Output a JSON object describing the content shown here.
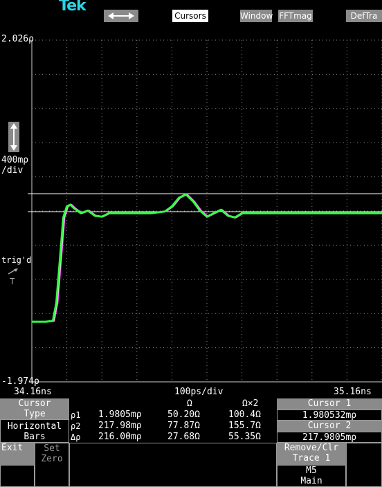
{
  "brand": "Tek",
  "top_menu": {
    "arrows_icon": "left-right-arrow-icon",
    "cursors": "Cursors",
    "window": "Window",
    "fftmag": "FFTmag",
    "deftra": "DefTra"
  },
  "scale": {
    "top_value": "2.026ρ",
    "bottom_value": "-1.974ρ",
    "vertical_div": "400mρ",
    "vertical_div_unit": "/div",
    "updown_icon": "up-down-arrow-icon",
    "trig_label": "trig'd",
    "trig_icon": "trigger-icon",
    "trig_letter": "T",
    "time_left": "34.16ns",
    "time_div": "100ps/div",
    "time_right": "35.16ns"
  },
  "colors": {
    "trace_green": "#33ff44",
    "trace_magenta": "#ff44ff",
    "trace_white": "#ffffff",
    "brand_cyan": "#2ad4e8",
    "grid": "#8a8a8a"
  },
  "chart_data": {
    "type": "line",
    "x_range_ns": [
      34.16,
      35.16
    ],
    "y_range_rho": [
      -1.974,
      2.026
    ],
    "cursor_levels_rho": [
      0.218,
      0.0
    ],
    "series": [
      {
        "x": [
          34.16,
          34.2,
          34.22,
          34.23,
          34.24,
          34.25,
          34.26,
          34.27,
          34.28,
          34.3,
          34.32,
          34.34,
          34.36,
          34.38,
          34.42,
          34.46,
          34.5,
          34.54,
          34.56,
          34.58,
          34.6,
          34.62,
          34.64,
          34.66,
          34.68,
          34.7,
          34.72,
          34.74,
          34.76,
          34.78,
          34.8,
          35.0,
          35.16
        ],
        "y": [
          -1.27,
          -1.27,
          -1.26,
          -1.05,
          -0.55,
          -0.05,
          0.08,
          0.1,
          0.06,
          0.0,
          0.03,
          -0.03,
          -0.04,
          0.0,
          0.0,
          0.0,
          0.0,
          0.02,
          0.08,
          0.18,
          0.22,
          0.14,
          0.03,
          -0.04,
          0.0,
          0.04,
          -0.03,
          -0.05,
          0.0,
          0.0,
          0.0,
          0.0,
          0.0
        ]
      }
    ]
  },
  "panel": {
    "cursor_type_l1": "Cursor",
    "cursor_type_l2": "Type",
    "cursor_type_l3": "Horizontal",
    "cursor_type_l4": "Bars",
    "col_omega": "Ω",
    "col_omega2": "Ω×2",
    "rows": [
      {
        "label": "ρ1",
        "value": "1.9805mρ",
        "ohm": "50.20Ω",
        "ohm2": "100.4Ω"
      },
      {
        "label": "ρ2",
        "value": "217.98mρ",
        "ohm": "77.87Ω",
        "ohm2": "155.7Ω"
      },
      {
        "label": "Δρ",
        "value": "216.00mρ",
        "ohm": "27.68Ω",
        "ohm2": "55.35Ω"
      }
    ],
    "cursor1_label": "Cursor 1",
    "cursor1_value": "1.980532mρ",
    "cursor2_label": "Cursor 2",
    "cursor2_value": "217.9805mρ",
    "exit": "Exit",
    "set_zero_l1": "Set",
    "set_zero_l2": "Zero",
    "remove_l1": "Remove/Clr",
    "remove_l2": "Trace 1",
    "m5_l1": "M5",
    "m5_l2": "Main"
  }
}
